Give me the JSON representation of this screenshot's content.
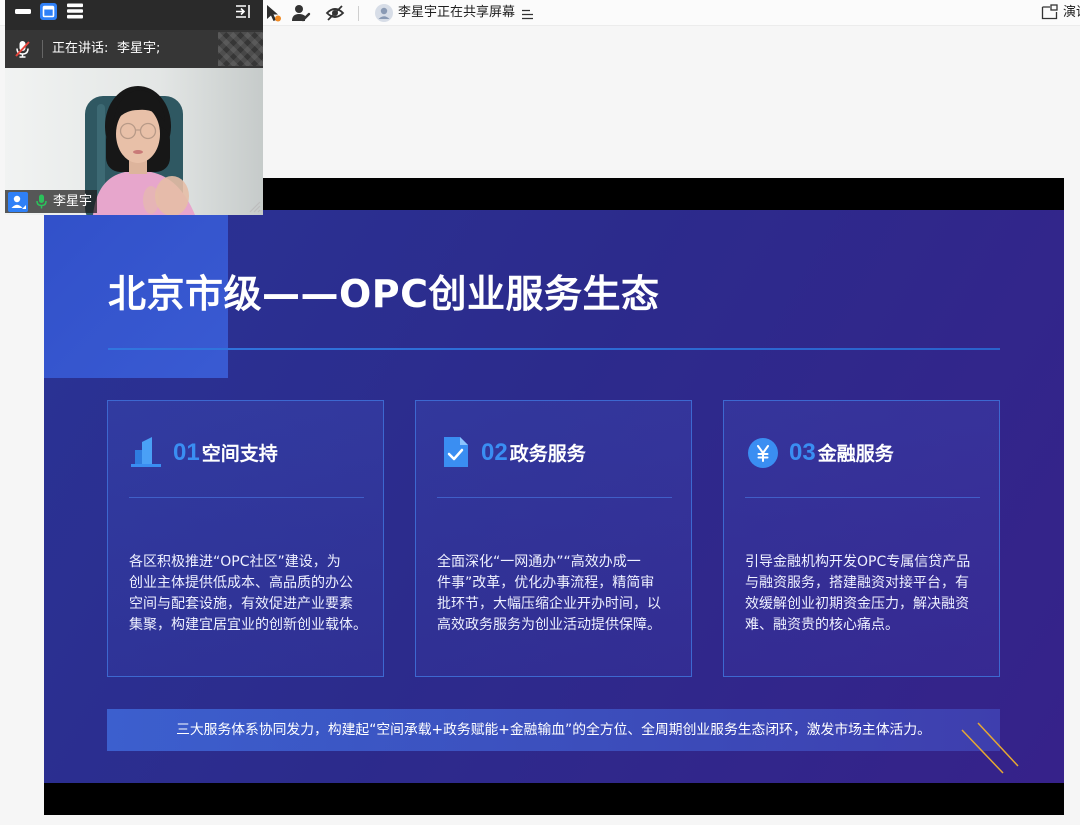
{
  "toolbar": {
    "sharing_text": "李星宇正在共享屏幕",
    "view_label": "演讲",
    "icons": {
      "remote_control": "remote-control-icon",
      "annotate": "annotate-icon",
      "hide": "eye-off-icon",
      "presenter_avatar": "avatar-icon",
      "sharing_menu": "sharing-menu-icon",
      "view_layout": "layout-icon"
    }
  },
  "video_window": {
    "speaking_label": "正在讲话:",
    "speaking_name": "李星宇;",
    "participant_name": "李星宇",
    "icons": {
      "minimize": "minimize-icon",
      "window": "window-icon",
      "list": "list-view-icon",
      "collapse": "collapse-panel-icon",
      "mic": "mic-off-icon",
      "participant_badge": "participant-badge-icon",
      "participant_mic": "mic-on-icon"
    }
  },
  "slide": {
    "title": "北京市级——OPC创业服务生态",
    "cards": [
      {
        "number": "01",
        "heading": "空间支持",
        "icon": "building-icon",
        "lines": [
          "各区积极推进“OPC社区”建设，为",
          "创业主体提供低成本、高品质的办公",
          "空间与配套设施，有效促进产业要素",
          "集聚，构建宜居宜业的创新创业载体。"
        ]
      },
      {
        "number": "02",
        "heading": "政务服务",
        "icon": "document-check-icon",
        "lines": [
          "全面深化“一网通办”“高效办成一",
          "件事”改革，优化办事流程，精简审",
          "批环节，大幅压缩企业开办时间，以",
          "高效政务服务为创业活动提供保障。"
        ]
      },
      {
        "number": "03",
        "heading": "金融服务",
        "icon": "yen-coin-icon",
        "lines": [
          "引导金融机构开发OPC专属信贷产品",
          "与融资服务，搭建融资对接平台，有",
          "效缓解创业初期资金压力，解决融资",
          "难、融资贵的核心痛点。"
        ]
      }
    ],
    "summary": "三大服务体系协同发力，构建起“空间承载+政务赋能+金融输血”的全方位、全周期创业服务生态闭环，激发市场主体活力。"
  },
  "colors": {
    "slide_background": "#2b2c8e",
    "accent_blue": "#3a8ef2",
    "card_border": "#3d68d0",
    "decor_gold": "#e6a832",
    "speaking_green": "#2bc25b",
    "mic_muted_red": "#e8453c",
    "badge_blue": "#2f80f7"
  }
}
